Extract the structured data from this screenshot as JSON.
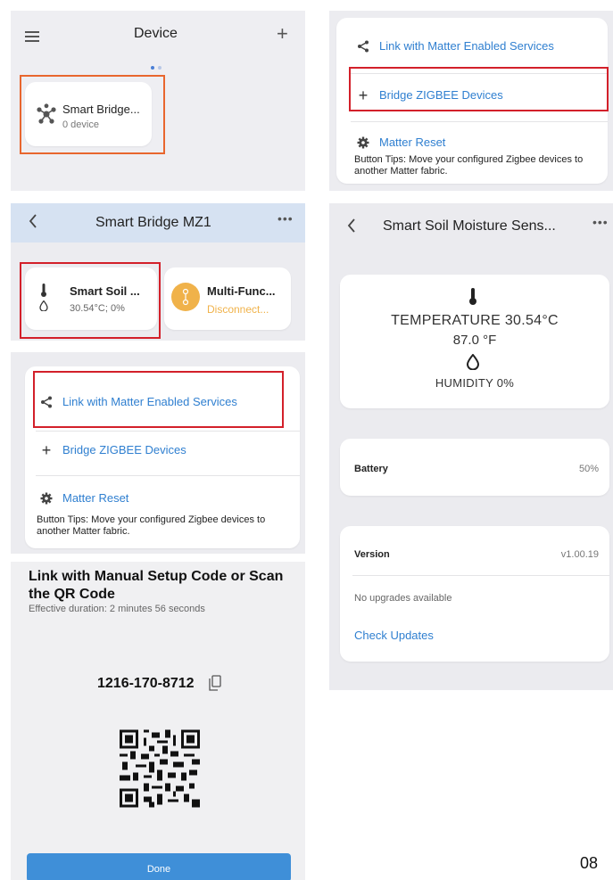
{
  "panel1": {
    "title": "Device",
    "card_name": "Smart Bridge...",
    "card_sub": "0 device"
  },
  "panel2": {
    "link": "Link with Matter Enabled Services",
    "bridge": "Bridge ZIGBEE Devices",
    "reset": "Matter Reset",
    "tips": "Button Tips: Move your configured Zigbee devices to another Matter fabric."
  },
  "panel3": {
    "title": "Smart Bridge MZ1",
    "card1_name": "Smart Soil ...",
    "card1_sub": "30.54°C; 0%",
    "card2_name": "Multi-Func...",
    "card2_status": "Disconnect..."
  },
  "panel4": {
    "link": "Link with Matter Enabled Services",
    "bridge": "Bridge ZIGBEE Devices",
    "reset": "Matter Reset",
    "tips": "Button Tips: Move your configured Zigbee devices to another Matter fabric."
  },
  "panel5": {
    "heading": "Link with Manual Setup Code or Scan the QR Code",
    "duration": "Effective duration: 2 minutes 56 seconds",
    "code": "1216-170-8712",
    "done": "Done"
  },
  "panel6": {
    "title": "Smart Soil Moisture Sens...",
    "temperature": "TEMPERATURE 30.54°C",
    "fahrenheit": "87.0 °F",
    "humidity": "HUMIDITY 0%",
    "battery_label": "Battery",
    "battery_value": "50%",
    "version_label": "Version",
    "version_value": "v1.00.19",
    "no_upgrades": "No upgrades available",
    "check_updates": "Check Updates"
  },
  "page_number": "08",
  "colors": {
    "accent": "#2f7fd0",
    "highlight_red": "#d3202a",
    "highlight_orange": "#e8662e",
    "disconnected": "#f0b24a",
    "done_button": "#3f8fd8"
  }
}
